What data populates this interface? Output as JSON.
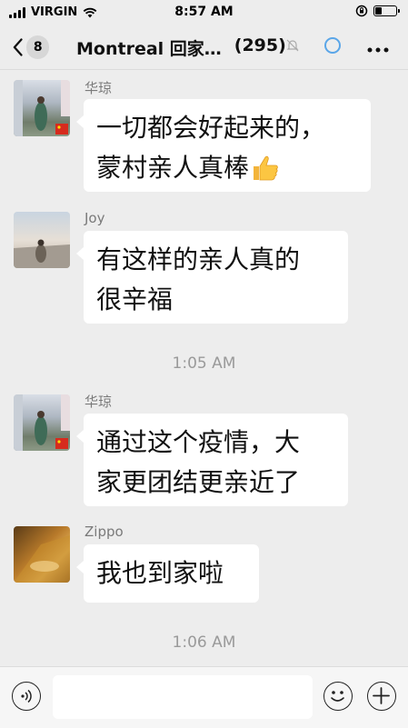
{
  "status_bar": {
    "carrier": "VIRGIN",
    "time": "8:57 AM",
    "icons": [
      "signal-icon",
      "wifi-icon",
      "lock-rotation-icon",
      "battery-icon"
    ]
  },
  "nav": {
    "unread_count": "8",
    "title": "Montreal 回家…",
    "member_count": "(295)",
    "icons": [
      "back-chevron-icon",
      "mute-bell-icon",
      "loading-icon",
      "more-icon"
    ]
  },
  "messages": [
    {
      "sender": "华琼",
      "lines": [
        "一切都会好起来的，",
        "蒙村亲人真棒"
      ],
      "emoji": "thumbs-up-icon"
    },
    {
      "sender": "Joy",
      "lines": [
        "有这样的亲人真的",
        "很辛福"
      ]
    },
    {
      "sender": "华琼",
      "lines": [
        "通过这个疫情，大",
        "家更团结更亲近了"
      ]
    },
    {
      "sender": "Zippo",
      "lines": [
        "我也到家啦"
      ]
    }
  ],
  "timestamps": [
    "1:05 AM",
    "1:06 AM"
  ],
  "input": {
    "value": "",
    "icons": [
      "voice-icon",
      "emoji-icon",
      "plus-icon"
    ]
  },
  "colors": {
    "background": "#ededed",
    "bubble": "#ffffff",
    "accent": "#5aa6e8"
  }
}
